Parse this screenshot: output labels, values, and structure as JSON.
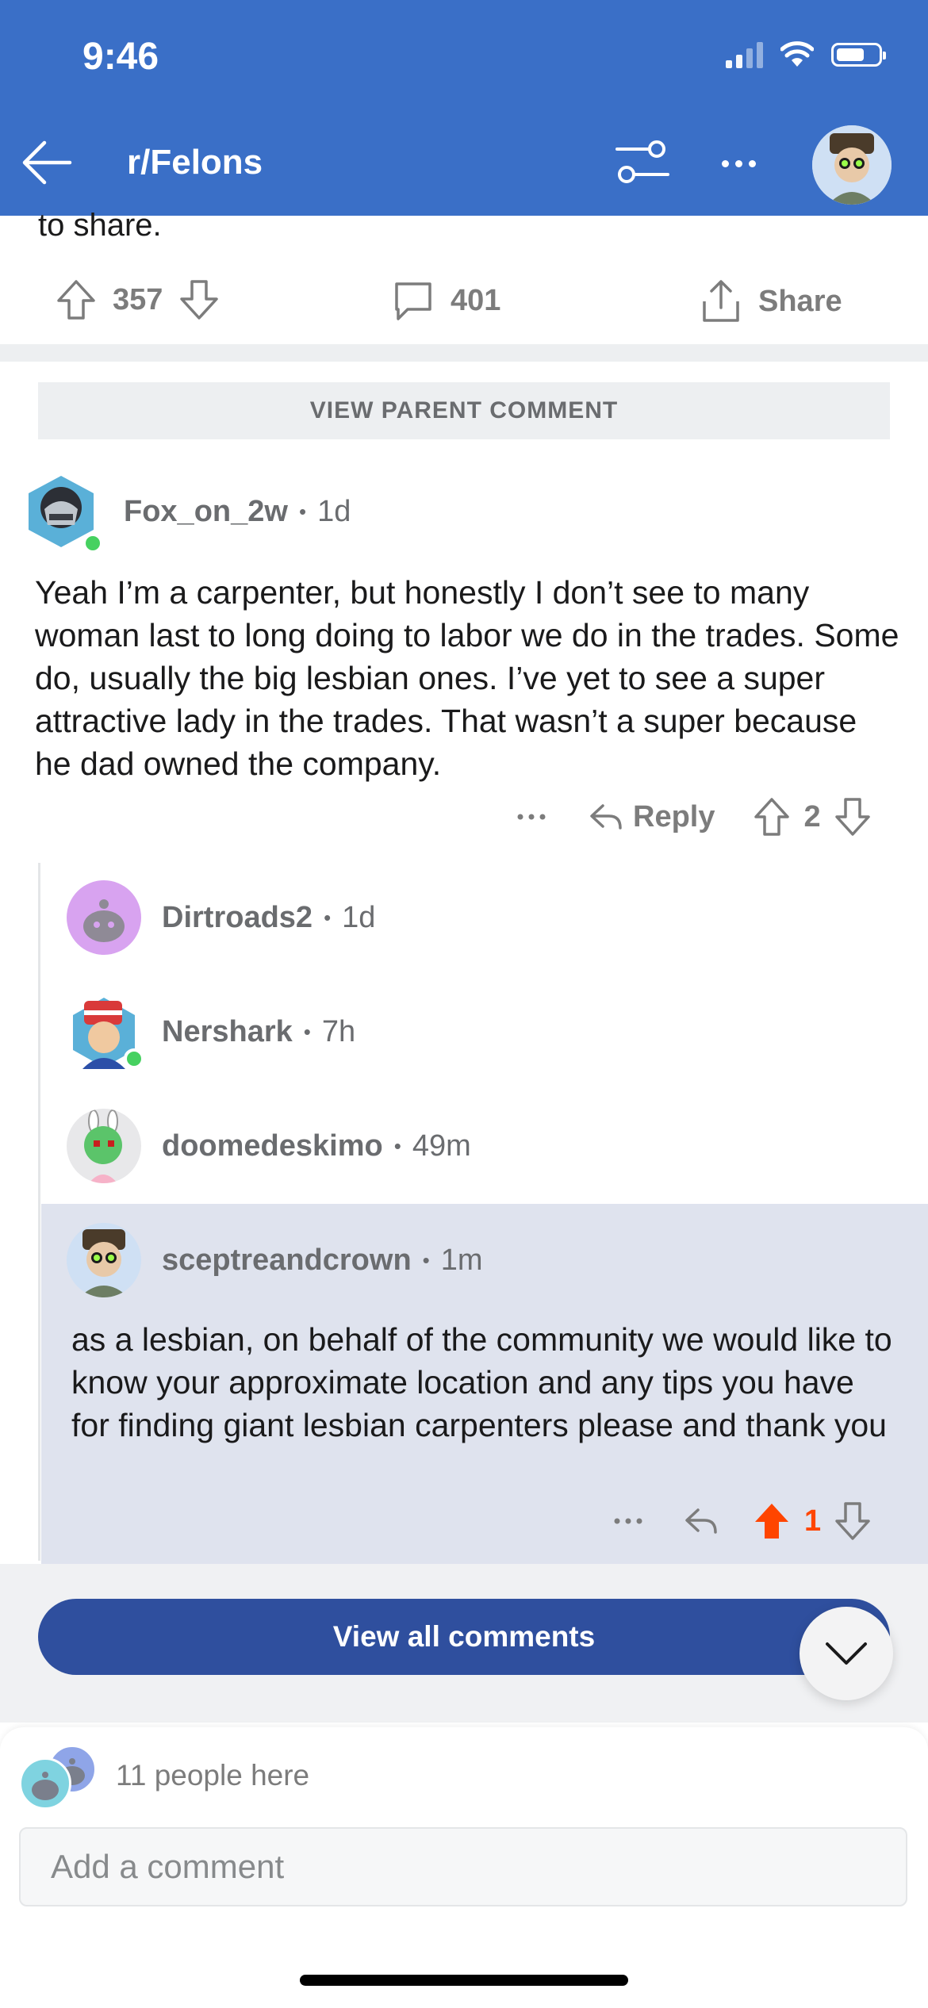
{
  "status_bar": {
    "time": "9:46"
  },
  "header": {
    "subreddit": "r/Felons"
  },
  "post": {
    "text_tail": "to share.",
    "upvotes": "357",
    "comments": "401",
    "share_label": "Share"
  },
  "view_parent_label": "VIEW PARENT COMMENT",
  "comments": {
    "main": {
      "user": "Fox_on_2w",
      "age": "1d",
      "body": "Yeah I’m a carpenter, but honestly I don’t see to many woman last to long doing to labor we do in the trades. Some do, usually the big lesbian ones. I’ve yet to see a super attractive lady in the trades. That wasn’t a super because he dad owned the company.",
      "reply_label": "Reply",
      "score": "2"
    },
    "collapsed": [
      {
        "user": "Dirtroads2",
        "age": "1d"
      },
      {
        "user": "Nershark",
        "age": "7h"
      },
      {
        "user": "doomedeskimo",
        "age": "49m"
      }
    ],
    "highlighted": {
      "user": "sceptreandcrown",
      "age": "1m",
      "body": "as a lesbian, on behalf of the community we would like to know your approximate location and any tips you have for finding giant lesbian carpenters please and thank you",
      "score": "1"
    }
  },
  "separator": "•",
  "view_all_label": "View all comments",
  "composer": {
    "people_here": "11 people here",
    "placeholder": "Add a comment"
  },
  "colors": {
    "header_bg": "#3a6fc7",
    "upvote_active": "#ff4500",
    "view_all_bg": "#2f4f9e",
    "highlight_bg": "#dfe3ee"
  }
}
